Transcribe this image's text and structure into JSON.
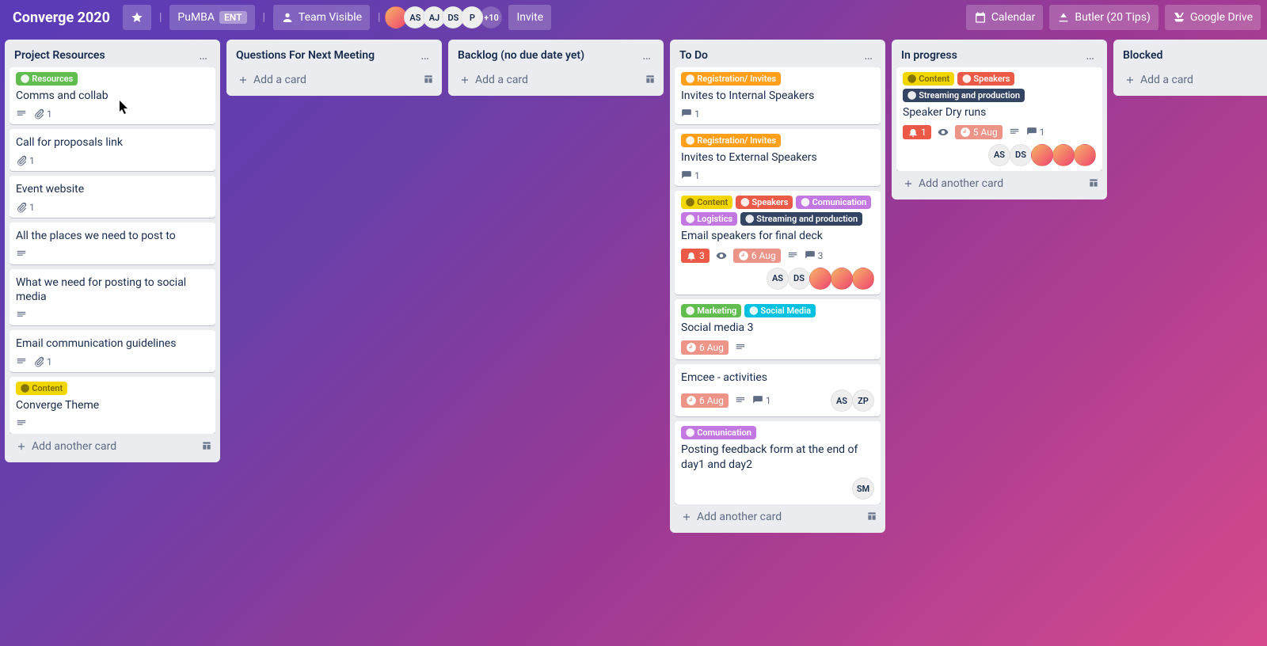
{
  "header": {
    "boardTitle": "Converge 2020",
    "team": {
      "name": "PuMBA",
      "badge": "ENT"
    },
    "visibility": "Team Visible",
    "memberInitials": [
      "AS",
      "AJ",
      "DS",
      "P"
    ],
    "moreCount": "+10",
    "invite": "Invite",
    "right": {
      "calendar": "Calendar",
      "butler": "Butler (20 Tips)",
      "drive": "Google Drive"
    }
  },
  "labelColors": {
    "Resources": "#61bd4f",
    "Registration/ Invites": "#ff9f1a",
    "Content": "#f2d600",
    "Speakers": "#eb5a46",
    "Comunication": "#c377e0",
    "Logistics": "#c377e0",
    "Streaming and production": "#344563",
    "Marketing": "#61bd4f",
    "Social Media": "#00c2e0"
  },
  "lists": [
    {
      "title": "Project Resources",
      "cards": [
        {
          "labels": [
            "Resources"
          ],
          "title": "Comms and collab",
          "desc": true,
          "attachments": 1
        },
        {
          "title": "Call for proposals link",
          "attachments": 1
        },
        {
          "title": "Event website",
          "attachments": 1
        },
        {
          "title": "All the places we need to post to",
          "desc": true
        },
        {
          "title": "What we need for posting to social media",
          "desc": true
        },
        {
          "title": "Email communication guidelines",
          "desc": true,
          "attachments": 1
        },
        {
          "labels": [
            "Content"
          ],
          "title": "Converge Theme",
          "desc": true
        }
      ],
      "addText": "Add another card"
    },
    {
      "title": "Questions For Next Meeting",
      "cards": [],
      "addText": "Add a card"
    },
    {
      "title": "Backlog (no due date yet)",
      "cards": [],
      "addText": "Add a card"
    },
    {
      "title": "To Do",
      "cards": [
        {
          "labels": [
            "Registration/ Invites"
          ],
          "title": "Invites to Internal Speakers",
          "comments": 1
        },
        {
          "labels": [
            "Registration/ Invites"
          ],
          "title": "Invites to External Speakers",
          "comments": 1
        },
        {
          "labels": [
            "Content",
            "Speakers",
            "Comunication",
            "Logistics",
            "Streaming and production"
          ],
          "title": "Email speakers for final deck",
          "notify": 3,
          "watch": true,
          "due": "6 Aug",
          "desc": true,
          "comments": 3,
          "members": [
            "AS",
            "DS",
            "img",
            "img",
            "img"
          ]
        },
        {
          "labels": [
            "Marketing",
            "Social Media"
          ],
          "title": "Social media 3",
          "due": "6 Aug",
          "desc": true
        },
        {
          "title": "Emcee - activities",
          "due": "6 Aug",
          "desc": true,
          "comments": 1,
          "members": [
            "AS",
            "ZP"
          ]
        },
        {
          "labels": [
            "Comunication"
          ],
          "title": "Posting feedback form at the end of day1 and day2",
          "members": [
            "SM"
          ]
        }
      ],
      "addText": "Add another card"
    },
    {
      "title": "In progress",
      "cards": [
        {
          "labels": [
            "Content",
            "Speakers",
            "Streaming and production"
          ],
          "title": "Speaker Dry runs",
          "notify": 1,
          "watch": true,
          "due": "5 Aug",
          "desc": true,
          "comments": 1,
          "members": [
            "AS",
            "DS",
            "img",
            "img",
            "img"
          ]
        }
      ],
      "addText": "Add another card"
    },
    {
      "title": "Blocked",
      "cards": [],
      "addText": "Add a card"
    }
  ]
}
